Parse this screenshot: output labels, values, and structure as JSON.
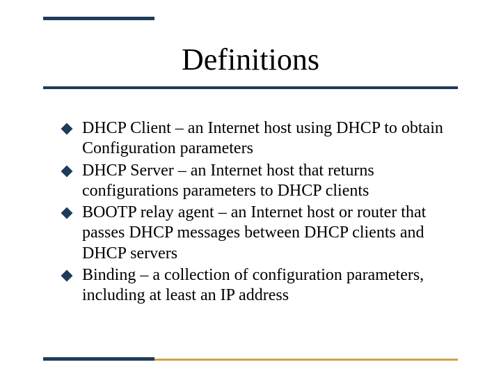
{
  "title": "Definitions",
  "colors": {
    "accent_dark": "#1f3b5b",
    "accent_gold": "#cda24a"
  },
  "bullets": [
    "DHCP Client – an Internet host using DHCP to obtain Configuration parameters",
    "DHCP Server – an Internet host that returns configurations parameters to DHCP clients",
    "BOOTP relay agent – an Internet host or router that passes DHCP messages between DHCP clients and DHCP servers",
    "Binding – a collection of configuration parameters, including at least an IP address"
  ]
}
